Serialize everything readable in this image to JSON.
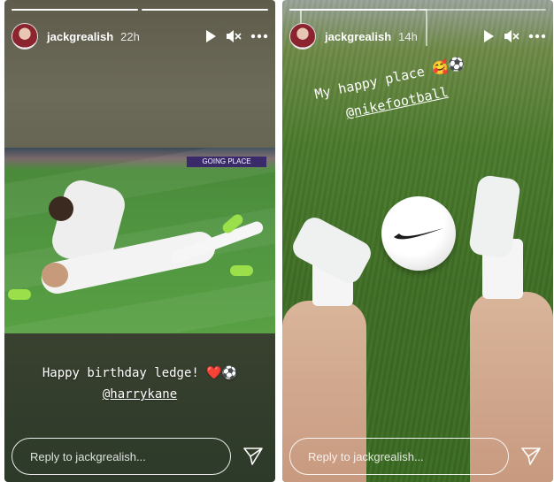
{
  "stories": [
    {
      "username": "jackgrealish",
      "time": "22h",
      "caption_line1": "Happy birthday ledge! ❤️⚽",
      "mention": "@harrykane",
      "photo_banner": "GOING PLACE",
      "reply_placeholder": "Reply to jackgrealish..."
    },
    {
      "username": "jackgrealish",
      "time": "14h",
      "caption_line1": "My happy place 🥰⚽",
      "mention": "@nikefootball",
      "reply_placeholder": "Reply to jackgrealish..."
    }
  ],
  "icons": {
    "play": "play-icon",
    "mute": "mute-icon",
    "more": "more-icon",
    "send": "send-icon"
  },
  "colors": {
    "text": "#ffffff",
    "heart": "#e0343b"
  }
}
